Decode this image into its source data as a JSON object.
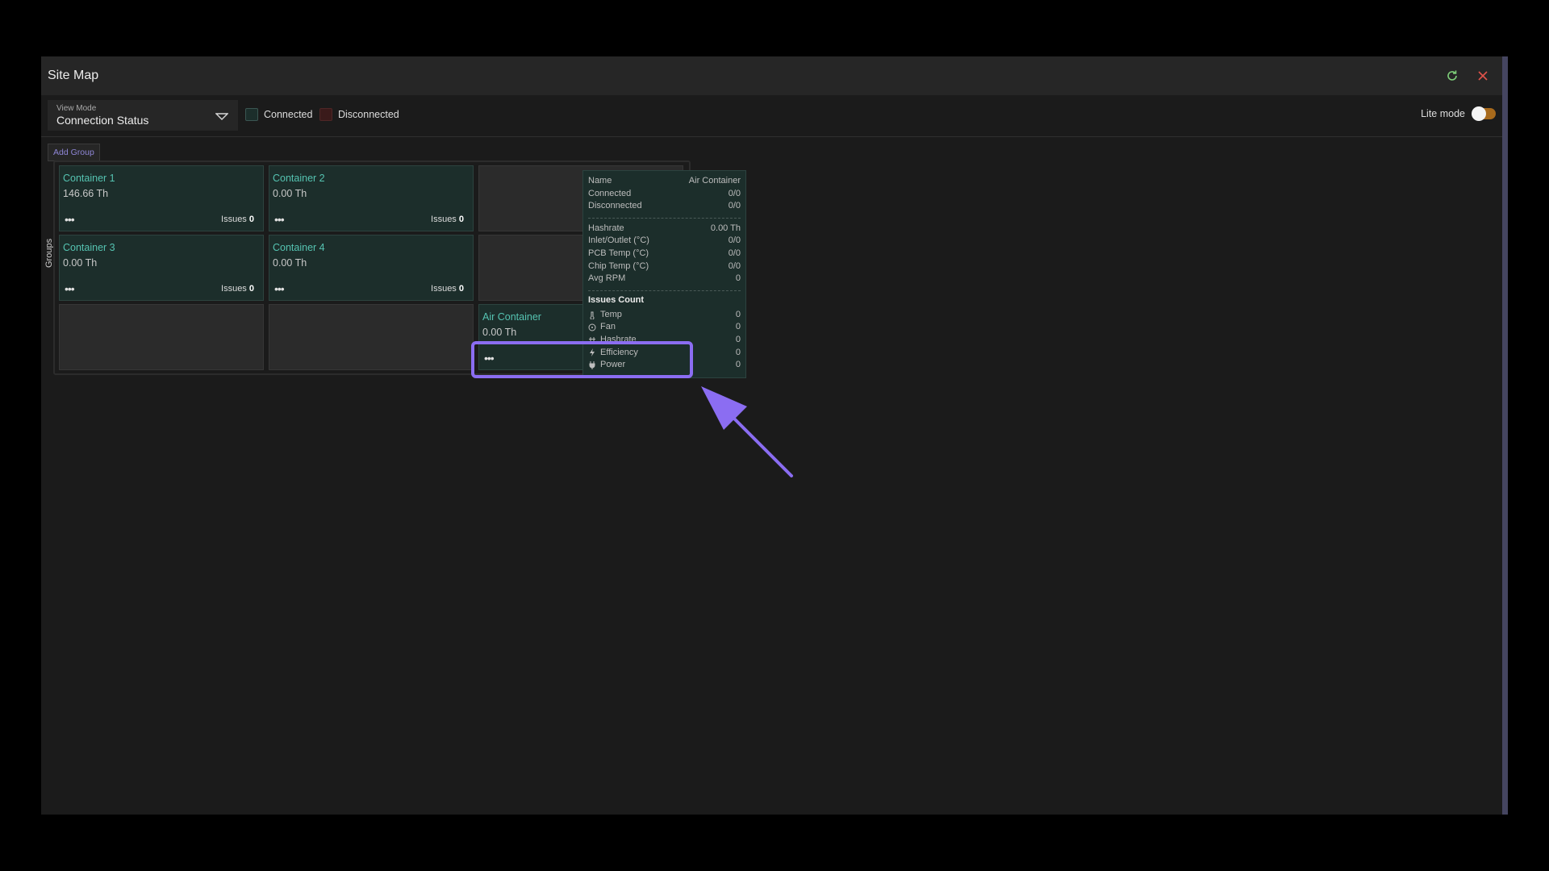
{
  "window": {
    "title": "Site Map",
    "refresh_icon": "refresh-icon",
    "close_icon": "close-icon"
  },
  "toolbar": {
    "view_mode_label": "View Mode",
    "view_mode_value": "Connection Status",
    "legend_connected": "Connected",
    "legend_disconnected": "Disconnected",
    "lite_mode_label": "Lite mode",
    "lite_mode_on": true
  },
  "add_group_label": "Add Group",
  "groups_label": "Groups",
  "containers": [
    {
      "name": "Container 1",
      "hashrate": "146.66 Th",
      "menu": "•••",
      "issues_label": "Issues",
      "issues": "0"
    },
    {
      "name": "Container 2",
      "hashrate": "0.00 Th",
      "menu": "•••",
      "issues_label": "Issues",
      "issues": "0"
    },
    {
      "name": "Container 3",
      "hashrate": "0.00 Th",
      "menu": "•••",
      "issues_label": "Issues",
      "issues": "0"
    },
    {
      "name": "Container 4",
      "hashrate": "0.00 Th",
      "menu": "•••",
      "issues_label": "Issues",
      "issues": "0"
    },
    {
      "name": "Air Container",
      "hashrate": "0.00 Th",
      "menu": "•••"
    }
  ],
  "tooltip": {
    "name_label": "Name",
    "name_value": "Air Container",
    "connected_label": "Connected",
    "connected_value": "0/0",
    "disconnected_label": "Disconnected",
    "disconnected_value": "0/0",
    "hashrate_label": "Hashrate",
    "hashrate_value": "0.00 Th",
    "inlet_label": "Inlet/Outlet (°C)",
    "inlet_value": "0/0",
    "pcb_label": "PCB Temp (°C)",
    "pcb_value": "0/0",
    "chip_label": "Chip Temp (°C)",
    "chip_value": "0/0",
    "rpm_label": "Avg RPM",
    "rpm_value": "0",
    "issues_heading": "Issues Count",
    "issues": [
      {
        "label": "Temp",
        "value": "0",
        "icon": "thermometer-icon"
      },
      {
        "label": "Fan",
        "value": "0",
        "icon": "fan-icon"
      },
      {
        "label": "Hashrate",
        "value": "0",
        "icon": "hashrate-icon"
      },
      {
        "label": "Efficiency",
        "value": "0",
        "icon": "lightning-icon"
      },
      {
        "label": "Power",
        "value": "0",
        "icon": "plug-icon"
      }
    ]
  },
  "colors": {
    "connected": "#1c2e2b",
    "disconnected": "#3a1a1a",
    "accent": "#8b6df2",
    "container_name": "#55c3b1"
  }
}
